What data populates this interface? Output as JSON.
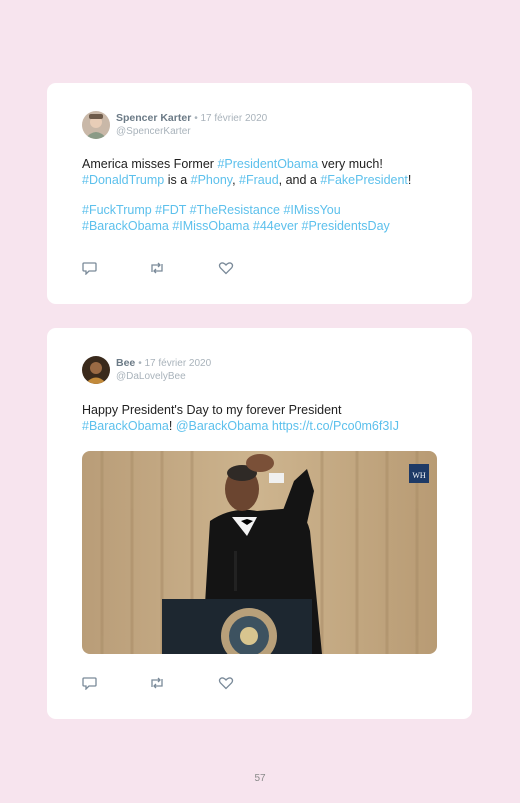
{
  "tweets": [
    {
      "name": "Spencer Karter",
      "date": "• 17 février 2020",
      "handle": "@SpencerKarter",
      "line1": {
        "t1": "America misses Former ",
        "l1": "#PresidentObama",
        "t2": " very much!"
      },
      "line2": {
        "l1": "#DonaldTrump",
        "t1": " is a ",
        "l2": "#Phony",
        "t2": ", ",
        "l3": "#Fraud",
        "t3": ", and a ",
        "l4": "#FakePresident",
        "t4": "!"
      },
      "line3": "#FuckTrump #FDT #TheResistance #IMissYou",
      "line4": "#BarackObama #IMissObama #44ever #PresidentsDay"
    },
    {
      "name": "Bee",
      "date": "• 17 février 2020",
      "handle": "@DaLovelyBee",
      "line1": "Happy President's Day to my forever President",
      "line2": {
        "l1": "#BarackObama",
        "t1": "! ",
        "l2": "@BarackObama",
        "t2": " ",
        "l3": "https://t.co/Pco0m6f3IJ"
      },
      "media_badge": "WH"
    }
  ],
  "icons": [
    "reply-icon",
    "retweet-icon",
    "like-icon"
  ],
  "colors": {
    "background": "#f7e4ee",
    "link": "#5cc0ec",
    "card": "#ffffff"
  },
  "page_number": "57"
}
